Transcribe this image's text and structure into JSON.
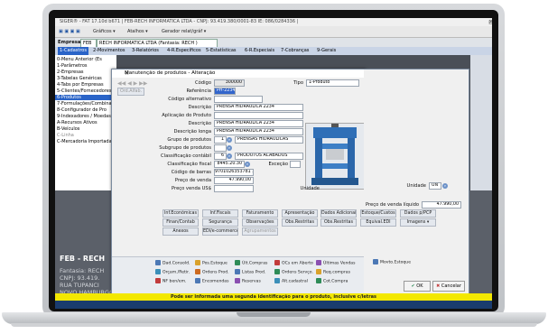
{
  "window": {
    "title": "SIGER® - FAT 17.10d b671 | FEB-RECH INFORMATICA LTDA - CNPJ: 93.419.380/0001-83 IE: 086/0284336 |",
    "buttons": [
      "–",
      "□",
      "×"
    ]
  },
  "toolbar": {
    "graficos": "Gráficos ▾",
    "atalhos": "Atalhos ▾",
    "gerador": "Gerador relat/gráf ▾"
  },
  "company": {
    "label": "Empresa",
    "code": "FEB",
    "value": "RECH INFORMATICA LTDA (Fantasia: RECH )"
  },
  "menu": {
    "items": [
      "1-Cadastros",
      "2-Movimentos",
      "3-Relatórios",
      "4-R.Específicos",
      "5-Estatísticas",
      "6-R.Especiais",
      "7-Cobranças",
      "9-Gerais"
    ]
  },
  "sidebar": {
    "items": [
      "0-Menu Anterior (Es",
      "1-Parâmetros",
      "2-Empresas",
      "3-Tabelas Genéricas",
      "4-Tabs por Empresas",
      "5-Clientes/Fornecedores",
      "6-Produtos",
      "7-Formulações/Combinações",
      "8-Configurador de Pro",
      "9-Indexadores / Moedas",
      "A-Recursos Ativos",
      "B-Veículos",
      "C-Linha",
      "C-Mercadoria Importada"
    ],
    "selected_index": 6
  },
  "background": {
    "company_short": "FEB - RECH",
    "lines": [
      "Fantasia: RECH",
      "CNPJ: 93.419.",
      "RUA TUPANCI",
      "NOVO HAMBURGO/RS"
    ]
  },
  "dialog": {
    "title": "Manutenção de produtos - Alteração",
    "nav": "◀◀ ◀ ▶ ▶▶",
    "fields": {
      "codigo_label": "Código",
      "codigo": "300000",
      "tipo_label": "Tipo",
      "tipo": "1-Produto",
      "ord_label": "Ord.Alfab.",
      "referencia_label": "Referência",
      "referencia": "PH-2234",
      "cod_alt_label": "Código alternativo",
      "descricao_label": "Descrição",
      "descricao": "PRENSA HIDRAULICA 2234",
      "aplicacao_label": "Aplicação do Produto",
      "descricao2_label": "Descrição",
      "descricao2": "PRENSA HIDRAULICA 2234",
      "desc_longa_label": "Descrição longa",
      "desc_longa": "PRENSA HIDRAULICA 2234",
      "grupo_label": "Grupo de produtos",
      "grupo_code": "1",
      "grupo": "PRENSAS HIDRAULICAS",
      "subgrupo_label": "Subgrupo de produtos",
      "classif_cont_label": "Classificação contábil",
      "classif_cont_code": "6",
      "classif_cont": "PRODUTOS ACABADOS",
      "classif_fiscal_label": "Classificação fiscal",
      "classif_fiscal": "8445.20.30",
      "excecao_label": "Exceção",
      "unidade_label": "Unidade",
      "unidade": "UN",
      "cod_barras_label": "Código de barras",
      "cod_barras": "9701026353781 3",
      "preco_venda_label": "Preço de venda",
      "preco_venda": "47.990,00",
      "preco_liquido_label": "Preço de venda líquido",
      "preco_liquido": "47.990,00",
      "preco_usd_label": "Preço venda US$"
    },
    "buttons_row1": [
      "Inf.Econômicas",
      "Inf.Fiscais",
      "Faturamento",
      "Apresentação",
      "Dados Adicionais",
      "Estoque/Custos",
      "Dados p/PCP"
    ],
    "buttons_row2": [
      "Finan/Contab",
      "Segurança",
      "Observações",
      "Obs.Restritas",
      "Obs.Restritas",
      "Equival.EDI",
      "Imagens ▾"
    ],
    "buttons_row3": [
      "Anexos",
      "EDI/e-commerce",
      "Agrupamentos"
    ],
    "actions": [
      [
        "Dad.Consold.",
        "Pos.Estoque",
        "Últ.Compras",
        "OCs em Aberto",
        "Últimas Vendas",
        "Movto.Estoque"
      ],
      [
        "Orçam./Retir.",
        "Ordens Prod.",
        "Listas Prod.",
        "Ordens Servço.",
        "Req.compras"
      ],
      [
        "NF ben/em.",
        "Encomendas",
        "Reservas",
        "Alt.cadastral",
        "Cot.Compra"
      ]
    ],
    "ok": "OK",
    "cancel": "Cancelar"
  },
  "status": {
    "message": "Pode ser informada uma segunda identificação para o produto, inclusive c/letras"
  },
  "colors": {
    "selection": "#2a64c8",
    "status_bar": "#f3e800",
    "menu_bar": "#c9d4e6"
  }
}
